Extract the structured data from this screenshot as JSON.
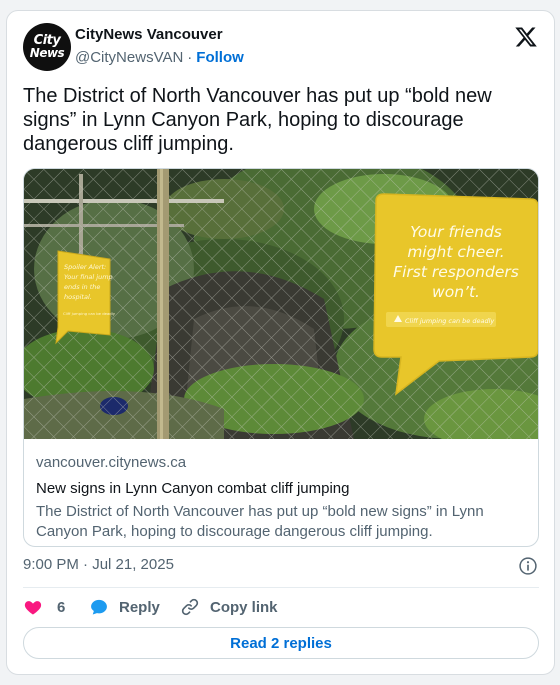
{
  "author": {
    "avatar_line1": "City",
    "avatar_line2": "News",
    "display_name": "CityNews Vancouver",
    "handle": "@CityNewsVAN",
    "separator": "·",
    "follow_label": "Follow"
  },
  "tweet": {
    "text": "The District of North Vancouver has put up “bold new signs” in Lynn Canyon Park, hoping to discourage dangerous cliff jumping."
  },
  "link_card": {
    "domain": "vancouver.citynews.ca",
    "title": "New signs in Lynn Canyon combat cliff jumping",
    "description": "The District of North Vancouver has put up “bold new signs” in Lynn Canyon Park, hoping to discourage dangerous cliff jumping.",
    "image": {
      "sign_large_lines": [
        "Your friends",
        "might cheer.",
        "First responders",
        "won’t."
      ],
      "sign_large_footer": "Cliff jumping can be deadly",
      "sign_small_lines": [
        "Spoiler Alert:",
        "Your final jump",
        "ends in the",
        "hospital."
      ],
      "sign_small_footer": "Cliff jumping can be deadly"
    }
  },
  "timestamp": "9:00 PM · Jul 21, 2025",
  "actions": {
    "like_count": "6",
    "reply_label": "Reply",
    "copy_label": "Copy link"
  },
  "read_replies_label": "Read 2 replies",
  "colors": {
    "accent": "#006fd6",
    "like": "#f91880",
    "reply": "#1d9bf0",
    "secondary_text": "#536471",
    "sign_yellow": "#e8c62a"
  }
}
